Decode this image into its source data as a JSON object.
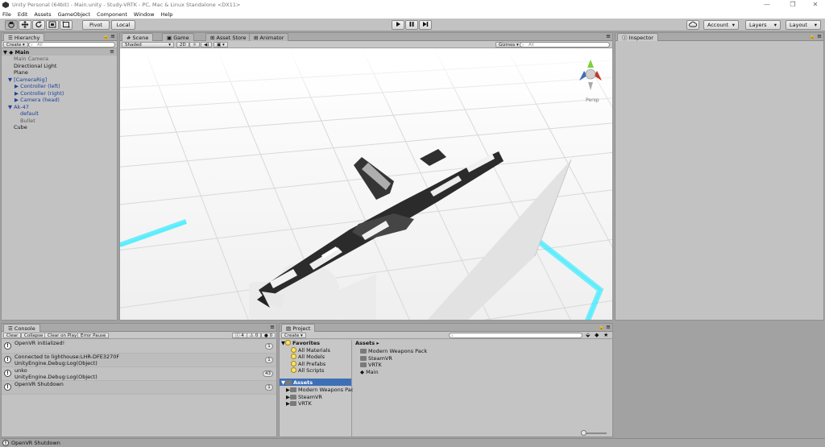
{
  "window": {
    "title": "Unity Personal (64bit) - Main.unity - Study-VRTK - PC, Mac & Linux Standalone <DX11>",
    "minimize": "—",
    "maximize": "❐",
    "close": "✕"
  },
  "menu": [
    "File",
    "Edit",
    "Assets",
    "GameObject",
    "Component",
    "Window",
    "Help"
  ],
  "toolbar": {
    "pivot": "Pivot",
    "local": "Local",
    "account": "Account",
    "layers": "Layers",
    "layout": "Layout",
    "icons": {
      "hand": "hand-icon",
      "move": "move-icon",
      "rotate": "rotate-icon",
      "scale": "scale-icon",
      "rect": "rect-icon",
      "play": "play-icon",
      "pause": "pause-icon",
      "step": "step-icon",
      "cloud": "cloud-icon"
    }
  },
  "hierarchy": {
    "tab": "Hierarchy",
    "create": "Create",
    "search_placeholder": "All",
    "items": [
      {
        "label": "Main",
        "style": "scene"
      },
      {
        "label": "Main Camera",
        "style": "grey"
      },
      {
        "label": "Directional Light",
        "style": "normal"
      },
      {
        "label": "Plane",
        "style": "normal"
      },
      {
        "label": "[CameraRig]",
        "style": "blue"
      },
      {
        "label": "Controller (left)",
        "style": "blue"
      },
      {
        "label": "Controller (right)",
        "style": "blue"
      },
      {
        "label": "Camera (head)",
        "style": "blue"
      },
      {
        "label": "Ak-47",
        "style": "blue"
      },
      {
        "label": "default",
        "style": "blue"
      },
      {
        "label": "Bullet",
        "style": "grey"
      },
      {
        "label": "Cube",
        "style": "normal"
      }
    ]
  },
  "scene": {
    "tabs": [
      "Scene",
      "Game",
      "Asset Store",
      "Animator"
    ],
    "shading": "Shaded",
    "mode_2d": "2D",
    "gizmos": "Gizmos",
    "search_placeholder": "All",
    "persp_label": "Persp"
  },
  "inspector": {
    "tab": "Inspector"
  },
  "console": {
    "tab": "Console",
    "buttons": [
      "Clear",
      "Collapse",
      "Clear on Play",
      "Error Pause"
    ],
    "counts": {
      "info": "4",
      "warn": "0",
      "error": "0"
    },
    "entries": [
      {
        "line1": "OpenVR initialized!",
        "line2": "",
        "count": "1"
      },
      {
        "line1": "Connected to lighthouse:LHR-DFE3270F",
        "line2": "UnityEngine.Debug:Log(Object)",
        "count": "1"
      },
      {
        "line1": "unko",
        "line2": "UnityEngine.Debug:Log(Object)",
        "count": "43"
      },
      {
        "line1": "OpenVR Shutdown",
        "line2": "",
        "count": "1"
      }
    ]
  },
  "project": {
    "tab": "Project",
    "create": "Create",
    "favorites_label": "Favorites",
    "favorites": [
      "All Materials",
      "All Models",
      "All Prefabs",
      "All Scripts"
    ],
    "assets_label": "Assets",
    "tree": [
      "Modern Weapons Pack",
      "SteamVR",
      "VRTK"
    ],
    "breadcrumb": "Assets",
    "grid_items": [
      "Modern Weapons Pack",
      "SteamVR",
      "VRTK",
      "Main"
    ]
  },
  "status": {
    "message": "OpenVR Shutdown"
  },
  "colors": {
    "accent_cyan": "#00e5ff",
    "selection_blue": "#3d6fb6"
  }
}
